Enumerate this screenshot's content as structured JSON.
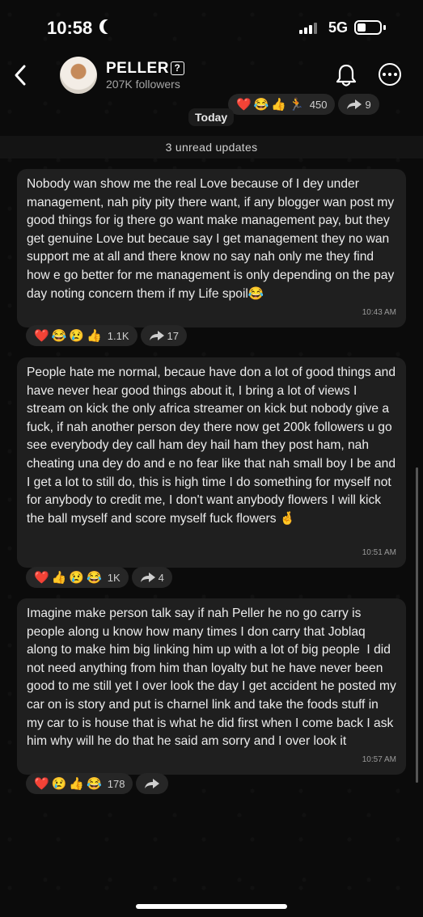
{
  "status_bar": {
    "time": "10:58",
    "network": "5G"
  },
  "header": {
    "name": "PELLER",
    "name_badge": "?",
    "followers": "207K followers"
  },
  "top_reactions": {
    "emojis": [
      "❤️",
      "😂",
      "👍",
      "🏃"
    ],
    "count": "450",
    "forwards": "9"
  },
  "date_separator": "Today",
  "unread_banner": "3 unread updates",
  "messages": [
    {
      "text": "Nobody wan show me the real Love because of I dey under management, nah pity pity there want, if any blogger wan post my good things for ig there go want make management pay, but they get genuine Love but becaue say I get management they no wan support me at all and there know no say nah only me they find how e go better for me management is only depending on the pay day noting concern them if my Life spoil😂",
      "time": "10:43 AM",
      "reactions": {
        "emojis": [
          "❤️",
          "😂",
          "😢",
          "👍"
        ],
        "count": "1.1K",
        "forwards": "17"
      }
    },
    {
      "text": "People hate me normal, becaue have don a lot of good things and have never hear good things about it, I bring a lot of views I stream on kick the only africa streamer on kick but nobody give a fuck, if nah another person dey there now get 200k followers u go see everybody dey call ham dey hail ham they post ham, nah cheating una dey do and e no fear like that nah small boy I be and I get a lot to still do, this is high time I do something for myself not for anybody to credit me, I don't want anybody flowers I will kick the ball myself and score myself fuck flowers 🤞",
      "time": "10:51 AM",
      "reactions": {
        "emojis": [
          "❤️",
          "👍",
          "😢",
          "😂"
        ],
        "count": "1K",
        "forwards": "4"
      }
    },
    {
      "text": "Imagine make person talk say if nah Peller he no go carry is people along u know how many times I don carry that Joblaq along to make him big linking him up with a lot of big people  I did not need anything from him than loyalty but he have never been good to me still yet I over look the day I get accident he posted my car on is story and put is charnel link and take the foods stuff in my car to is house that is what he did first when I come back I ask him why will he do that he said am sorry and I over look it",
      "time": "10:57 AM",
      "reactions": {
        "emojis": [
          "❤️",
          "😢",
          "👍",
          "😂"
        ],
        "count": "178",
        "forwards": ""
      }
    }
  ]
}
